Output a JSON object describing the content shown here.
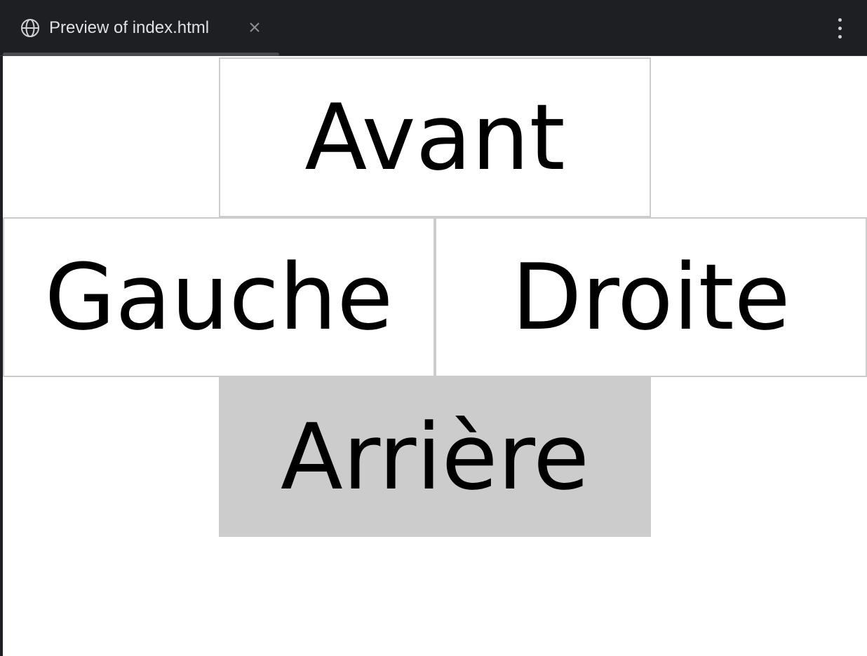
{
  "tab": {
    "title": "Preview of index.html",
    "icon": "globe-icon",
    "close_icon": "close-icon"
  },
  "toolbar": {
    "menu_icon": "more-vertical-icon"
  },
  "controls": {
    "avant": "Avant",
    "gauche": "Gauche",
    "droite": "Droite",
    "arriere": "Arrière",
    "active": "arriere"
  },
  "colors": {
    "topbar_bg": "#1e1f22",
    "cell_border": "#cccccc",
    "active_cell_bg": "#cccccc",
    "text": "#000000"
  }
}
